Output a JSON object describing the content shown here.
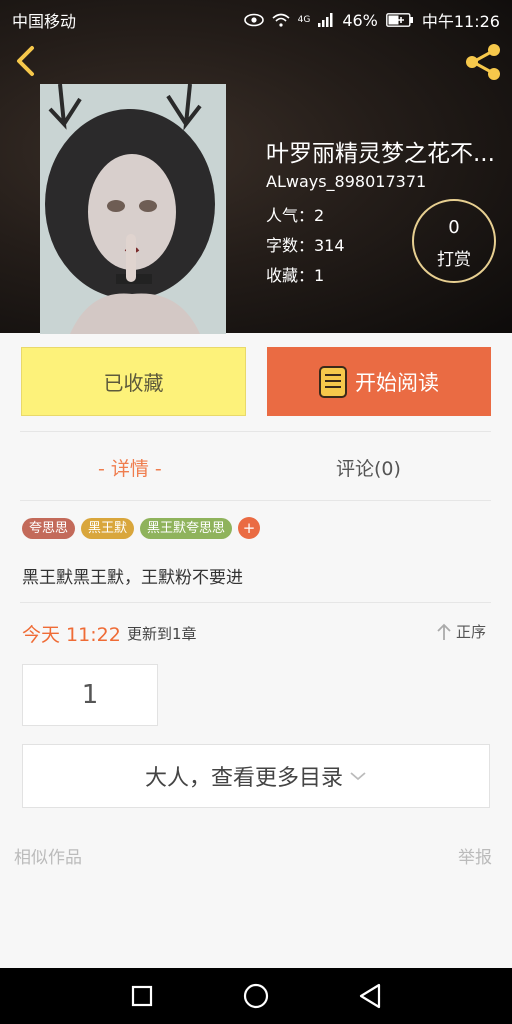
{
  "status_bar": {
    "carrier": "中国移动",
    "network": "4G",
    "battery": "46%",
    "time": "中午11:26"
  },
  "book": {
    "title": "叶罗丽精灵梦之花不...",
    "author": "ALways_898017371",
    "popularity_label": "人气：2",
    "word_count_label": "字数：314",
    "favorites_label": "收藏：1"
  },
  "reward": {
    "count": "0",
    "label": "打赏"
  },
  "actions": {
    "favorited_label": "已收藏",
    "start_reading_label": "开始阅读"
  },
  "tabs": {
    "detail": "- 详情 -",
    "comments": "评论(0)"
  },
  "tags": [
    {
      "text": "夸思思",
      "color": "#c36a5a"
    },
    {
      "text": "黑王默",
      "color": "#d9a63c"
    },
    {
      "text": "黑王默夸思思",
      "color": "#8fb35c"
    }
  ],
  "tag_add": "+",
  "description": "黑王默黑王默，王默粉不要进",
  "update": {
    "time": "今天 11:22",
    "text": "更新到1章",
    "sort_label": "正序"
  },
  "chapter_number": "1",
  "more_toc": "大人，查看更多目录",
  "similar_label": "相似作品",
  "report_label": "举报",
  "colors": {
    "accent_orange": "#ea6b43",
    "favorite_yellow": "#fdf27a",
    "header_gold": "#e7cf91"
  }
}
